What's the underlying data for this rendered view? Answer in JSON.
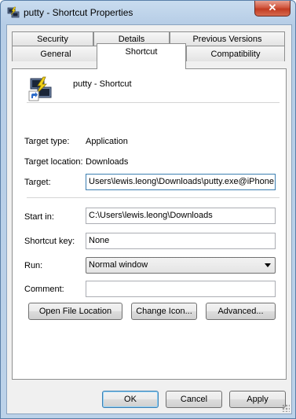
{
  "window": {
    "title": "putty - Shortcut Properties",
    "close_label": "✕"
  },
  "tabs": {
    "row1": [
      "Security",
      "Details",
      "Previous Versions"
    ],
    "row2": [
      "General",
      "Shortcut",
      "Compatibility"
    ],
    "active": "Shortcut"
  },
  "header": {
    "name": "putty - Shortcut"
  },
  "info": {
    "target_type_label": "Target type:",
    "target_type_value": "Application",
    "target_location_label": "Target location:",
    "target_location_value": "Downloads"
  },
  "fields": {
    "target_label": "Target:",
    "target_value": "Users\\lewis.leong\\Downloads\\putty.exe@iPhone",
    "start_in_label": "Start in:",
    "start_in_value": "C:\\Users\\lewis.leong\\Downloads",
    "shortcut_key_label": "Shortcut key:",
    "shortcut_key_value": "None",
    "run_label": "Run:",
    "run_value": "Normal window",
    "comment_label": "Comment:",
    "comment_value": ""
  },
  "actions": {
    "open_file_location": "Open File Location",
    "change_icon": "Change Icon...",
    "advanced": "Advanced..."
  },
  "dialog_buttons": {
    "ok": "OK",
    "cancel": "Cancel",
    "apply": "Apply"
  }
}
